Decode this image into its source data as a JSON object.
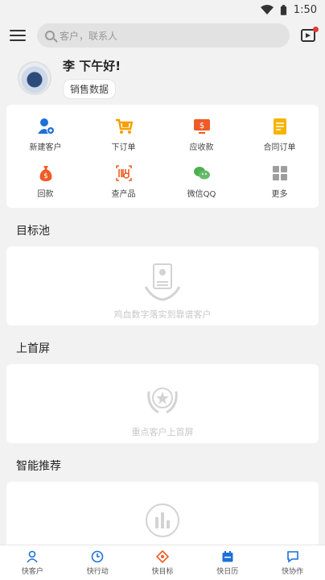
{
  "status": {
    "time": "1:50"
  },
  "search": {
    "placeholder": "客户，联系人"
  },
  "profile": {
    "greeting": "李 下午好!",
    "chip": "销售数据"
  },
  "actions": [
    {
      "label": "新建客户",
      "icon": "add-user-icon",
      "color": "#1e6fd9"
    },
    {
      "label": "下订单",
      "icon": "cart-icon",
      "color": "#f5a000"
    },
    {
      "label": "应收款",
      "icon": "monitor-dollar-icon",
      "color": "#ef5b25"
    },
    {
      "label": "合同订单",
      "icon": "contract-icon",
      "color": "#f5b400"
    },
    {
      "label": "回款",
      "icon": "money-bag-icon",
      "color": "#ef5b25"
    },
    {
      "label": "查产品",
      "icon": "barcode-icon",
      "color": "#ef5b25"
    },
    {
      "label": "微信QQ",
      "icon": "wechat-icon",
      "color": "#4caf50"
    },
    {
      "label": "更多",
      "icon": "grid-icon",
      "color": "#9e9e9e"
    }
  ],
  "sections": [
    {
      "title": "目标池",
      "caption": "鸡血数字落实到靠谱客户"
    },
    {
      "title": "上首屏",
      "caption": "重点客户上首屏"
    },
    {
      "title": "智能推荐",
      "caption": ""
    }
  ],
  "tabs": [
    {
      "label": "快客户",
      "icon": "person-icon",
      "color": "#1e6fd9"
    },
    {
      "label": "快行动",
      "icon": "clock-icon",
      "color": "#1e6fd9"
    },
    {
      "label": "快目标",
      "icon": "target-icon",
      "color": "#ef5b25"
    },
    {
      "label": "快日历",
      "icon": "calendar-icon",
      "color": "#1e6fd9"
    },
    {
      "label": "快协作",
      "icon": "chat-icon",
      "color": "#1e6fd9"
    }
  ]
}
